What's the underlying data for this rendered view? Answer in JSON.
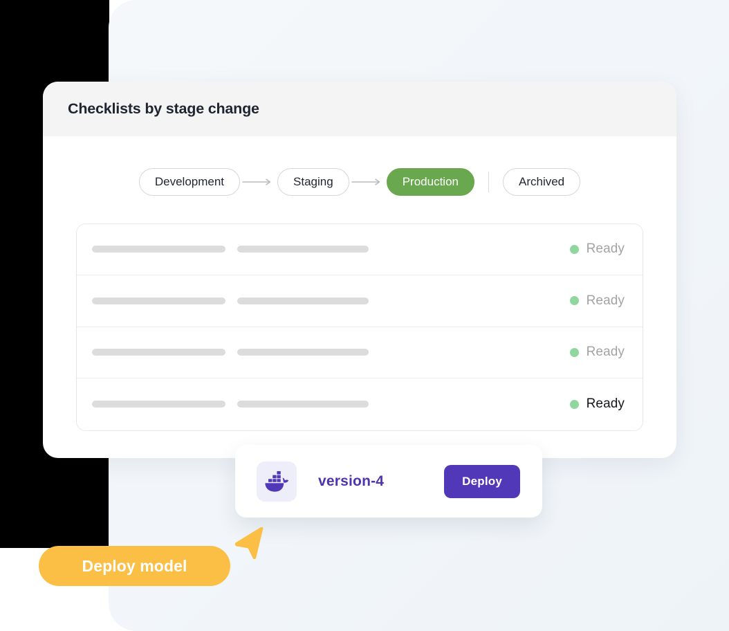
{
  "card": {
    "title": "Checklists by stage change"
  },
  "stages": {
    "items": [
      {
        "label": "Development",
        "active": false
      },
      {
        "label": "Staging",
        "active": false
      },
      {
        "label": "Production",
        "active": true
      },
      {
        "label": "Archived",
        "active": false
      }
    ],
    "arrow_icon": "arrow-right-icon",
    "separator": "vertical-divider",
    "active_color": "#6aa84f"
  },
  "checklist": {
    "rows": [
      {
        "status": "Ready",
        "emphasis": false
      },
      {
        "status": "Ready",
        "emphasis": false
      },
      {
        "status": "Ready",
        "emphasis": false
      },
      {
        "status": "Ready",
        "emphasis": true
      }
    ],
    "status_dot_color": "#8fd69f",
    "skeleton_color": "#dcdcdc"
  },
  "deploy_card": {
    "icon": "docker-whale-icon",
    "version": "version-4",
    "button_label": "Deploy",
    "button_color": "#5138b8",
    "version_color": "#4c35ae"
  },
  "callout": {
    "label": "Deploy model",
    "color": "#fbbf45",
    "cursor_icon": "cursor-arrow-icon"
  }
}
